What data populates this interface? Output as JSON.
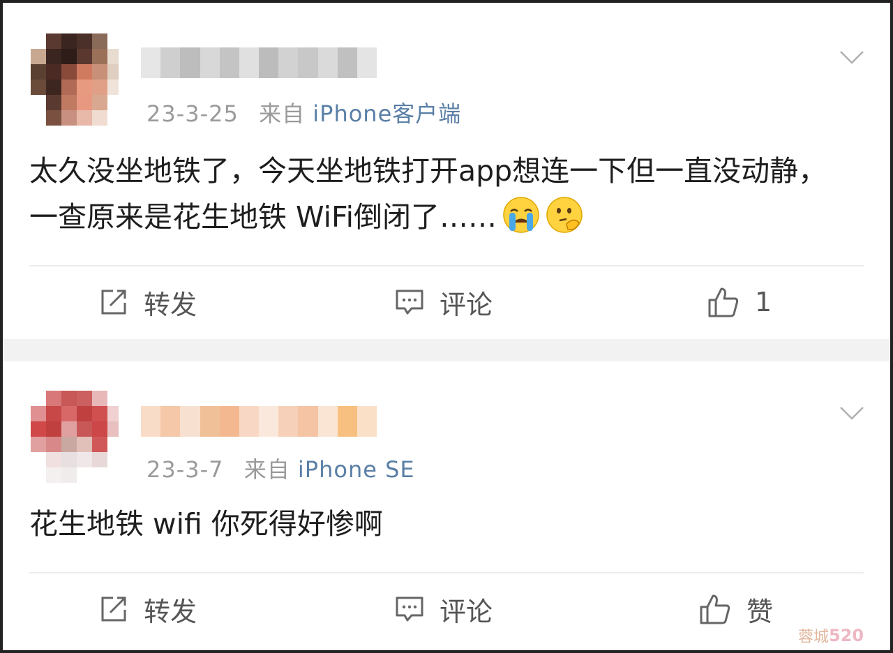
{
  "posts": [
    {
      "timestamp": "23-3-25",
      "source_prefix": "来自",
      "source_name": "iPhone客户端",
      "content": "太久没坐地铁了，今天坐地铁打开app想连一下但一直没动静，一查原来是花生地铁 WiFi倒闭了……",
      "emojis": [
        "crying-emoji",
        "thinking-emoji"
      ],
      "actions": {
        "repost": "转发",
        "comment": "评论",
        "like": "1"
      }
    },
    {
      "timestamp": "23-3-7",
      "source_prefix": "来自",
      "source_name": "iPhone SE",
      "content": "花生地铁 wifi 你死得好惨啊",
      "emojis": [],
      "actions": {
        "repost": "转发",
        "comment": "评论",
        "like": "赞"
      }
    }
  ],
  "icons": {
    "menu": "chevron-down-icon",
    "repost": "share-icon",
    "comment": "comment-icon",
    "like": "thumbs-up-icon"
  },
  "colors": {
    "source_link": "#5a7fa6",
    "meta_text": "#9a9a9a",
    "background": "#f2f2f2"
  },
  "watermark": {
    "text": "蓉城",
    "number": "520"
  }
}
